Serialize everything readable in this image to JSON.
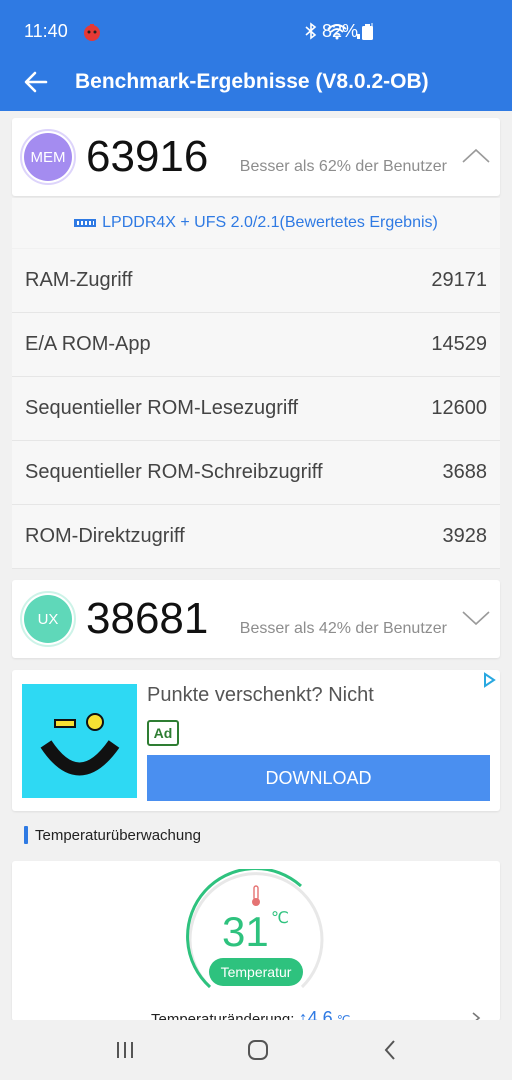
{
  "status_bar": {
    "time": "11:40",
    "battery": "82%"
  },
  "app_bar": {
    "title": "Benchmark-Ergebnisse (V8.0.2-OB)"
  },
  "mem": {
    "badge": "MEM",
    "score": "63916",
    "better_than": "Besser als 62% der Benutzer",
    "color": "#a48cf0",
    "memory_type": "LPDDR4X + UFS 2.0/2.1(Bewertetes Ergebnis)",
    "rows": [
      {
        "label": "RAM-Zugriff",
        "value": "29171"
      },
      {
        "label": "E/A ROM-App",
        "value": "14529"
      },
      {
        "label": "Sequentieller ROM-Lesezugriff",
        "value": "12600"
      },
      {
        "label": "Sequentieller ROM-Schreibzugriff",
        "value": "3688"
      },
      {
        "label": "ROM-Direktzugriff",
        "value": "3928"
      }
    ]
  },
  "ux": {
    "badge": "UX",
    "score": "38681",
    "better_than": "Besser als 42% der Benutzer",
    "color": "#5fd8b9"
  },
  "ad": {
    "title": "Punkte verschenkt? Nicht",
    "badge": "Ad",
    "button": "DOWNLOAD"
  },
  "temperature": {
    "section_title": "Temperaturüberwachung",
    "value": "31",
    "unit": "℃",
    "label": "Temperatur",
    "change_label": "Temperaturänderung:",
    "change_value": "↑4.6",
    "change_unit": "℃"
  },
  "colors": {
    "primary": "#2f7ae3",
    "accent_green": "#2ec27e"
  }
}
